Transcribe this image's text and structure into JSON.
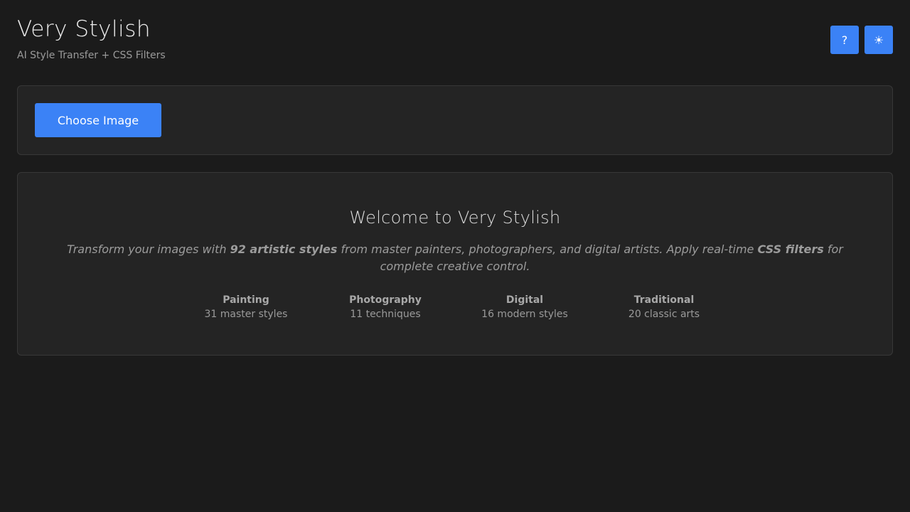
{
  "header": {
    "title": "Very Stylish",
    "subtitle": "AI Style Transfer + CSS Filters",
    "help_button": {
      "label": "?",
      "icon": "question-mark-icon"
    },
    "theme_button": {
      "label": "☀",
      "icon": "sun-icon"
    }
  },
  "upload": {
    "choose_label": "Choose Image"
  },
  "welcome": {
    "title": "Welcome to Very Stylish",
    "desc_part1": "Transform your images with ",
    "desc_bold1": "92 artistic styles",
    "desc_part2": " from master painters, photographers, and digital artists. Apply real-time ",
    "desc_bold2": "CSS filters",
    "desc_part3": " for complete creative control.",
    "categories": [
      {
        "name": "Painting",
        "count": "31 master styles"
      },
      {
        "name": "Photography",
        "count": "11 techniques"
      },
      {
        "name": "Digital",
        "count": "16 modern styles"
      },
      {
        "name": "Traditional",
        "count": "20 classic arts"
      }
    ]
  },
  "colors": {
    "background": "#1b1b1b",
    "panel": "#242424",
    "panel_border": "#383838",
    "accent": "#3b82f6",
    "text_muted": "#9a9a9a"
  }
}
